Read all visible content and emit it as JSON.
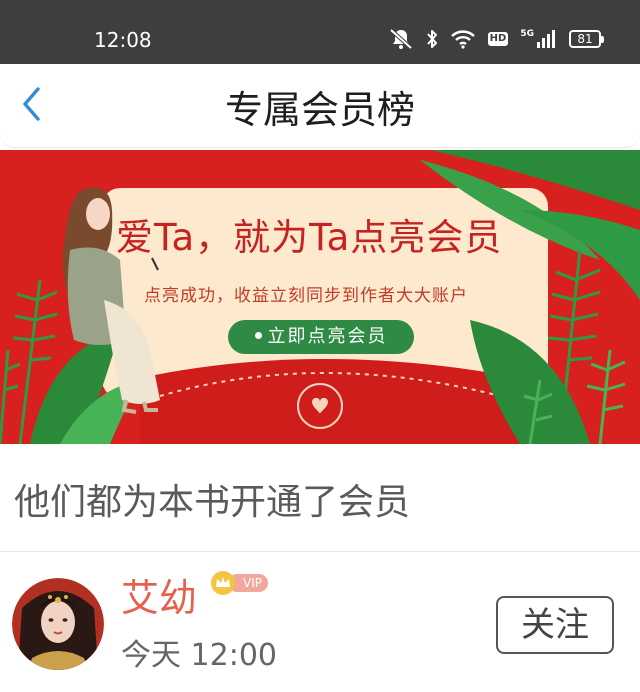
{
  "status_bar": {
    "time": "12:08",
    "hd_label": "HD",
    "network_label": "5G",
    "battery_level": "81",
    "icons": [
      "mute-bell-icon",
      "bluetooth-icon",
      "wifi-icon",
      "hd-icon",
      "signal-icon",
      "battery-icon"
    ]
  },
  "nav": {
    "title": "专属会员榜",
    "back_icon": "chevron-left-icon",
    "accent_color": "#2f8fd8"
  },
  "banner": {
    "headline": "爱Ta，就为Ta点亮会员",
    "subtitle": "点亮成功，收益立刻同步到作者大大账户",
    "cta_label": "立即点亮会员",
    "background_color": "#d8201e",
    "cta_color": "#2e8a45"
  },
  "section": {
    "title": "他们都为本书开通了会员"
  },
  "members": [
    {
      "name": "艾幼",
      "badge": "VIP",
      "time": "今天 12:00",
      "follow_label": "关注",
      "name_color": "#e8604d"
    }
  ]
}
